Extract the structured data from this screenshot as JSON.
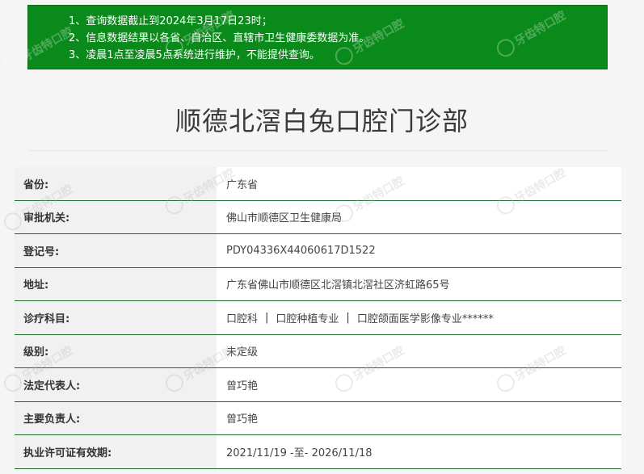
{
  "notice": {
    "lines": [
      "1、查询数据截止到2024年3月17日23时；",
      "2、信息数据结果以各省、自治区、直辖市卫生健康委数据为准。",
      "3、凌晨1点至凌晨5点系统进行维护，不能提供查询。"
    ]
  },
  "page_title": "顺德北滘白兔口腔门诊部",
  "watermark_text": "牙齿特口腔",
  "rows": [
    {
      "label": "省份:",
      "value": "广东省"
    },
    {
      "label": "审批机关:",
      "value": "佛山市顺德区卫生健康局"
    },
    {
      "label": "登记号:",
      "value": "PDY04336X44060617D1522"
    },
    {
      "label": "地址:",
      "value": "广东省佛山市顺德区北滘镇北滘社区济虹路65号"
    },
    {
      "label": "诊疗科目:",
      "value": "",
      "subjects": [
        "口腔科",
        "口腔种植专业",
        "口腔颌面医学影像专业******"
      ],
      "separator": "|"
    },
    {
      "label": "级别:",
      "value": "未定级"
    },
    {
      "label": "法定代表人:",
      "value": "曾巧艳"
    },
    {
      "label": "主要负责人:",
      "value": "曾巧艳"
    },
    {
      "label": "执业许可证有效期:",
      "value": "2021/11/19 -至- 2026/11/18"
    }
  ]
}
